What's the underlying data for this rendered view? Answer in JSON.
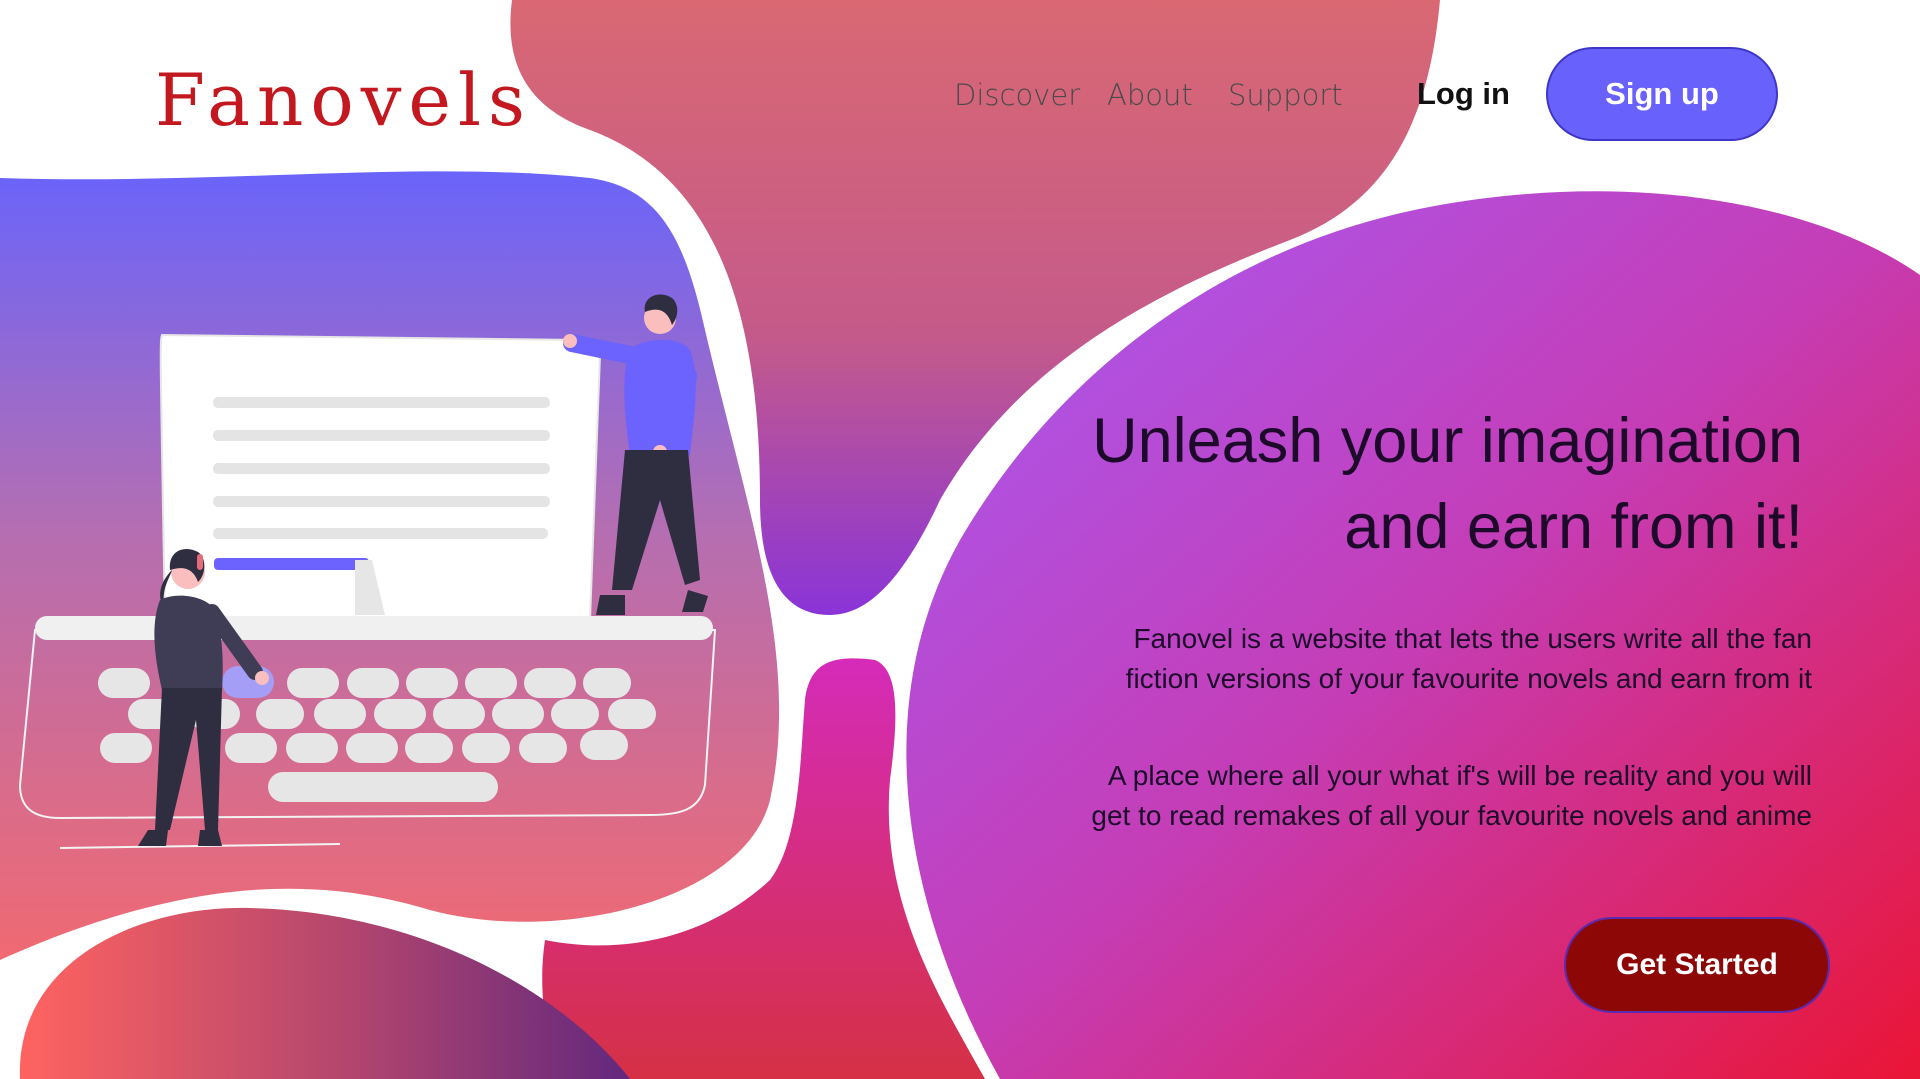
{
  "brand": {
    "name": "Fanovels",
    "color": "#c3181f"
  },
  "nav": {
    "links": [
      "Discover",
      "About",
      "Support"
    ],
    "login_label": "Log in",
    "signup_label": "Sign up"
  },
  "hero": {
    "headline_line1": "Unleash your imagination",
    "headline_line2": "and earn from it!",
    "para1_line1": "Fanovel is a website that lets the users write all the fan",
    "para1_line2": "fiction versions of your favourite novels and earn from it",
    "para2_line1": "A place where all your what if's will be reality and you will",
    "para2_line2": "get to read remakes of all your favourite novels and anime",
    "cta_label": "Get Started"
  },
  "colors": {
    "accent": "#6961fb",
    "cta": "#8e0707",
    "blob_purple": "#a159f5",
    "blob_pink": "#e5156b",
    "blob_coral": "#ff6360"
  },
  "illustration": {
    "icons": [
      "typewriter-icon",
      "person-standing-icon",
      "person-typing-icon"
    ]
  }
}
